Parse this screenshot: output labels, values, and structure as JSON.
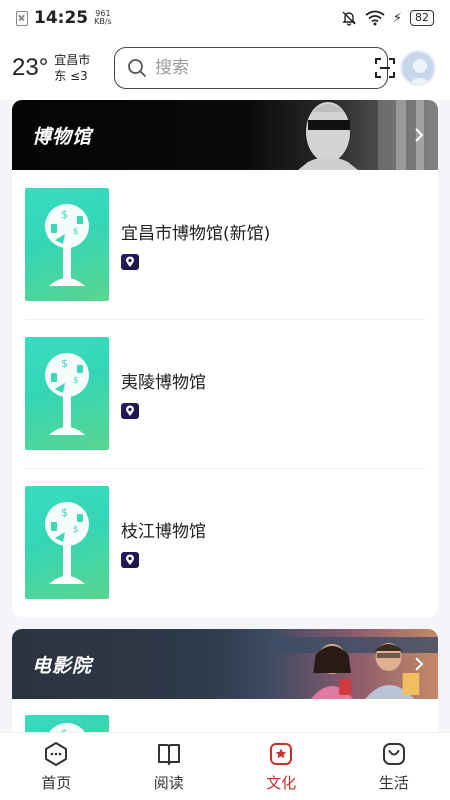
{
  "status": {
    "time": "14:25",
    "net_speed_value": "961",
    "net_speed_unit": "KB/s",
    "battery": "82"
  },
  "header": {
    "temperature": "23°",
    "city": "宜昌市",
    "wind": "东 ≤3",
    "search_placeholder": "搜索"
  },
  "sections": [
    {
      "title": "博物馆",
      "venues": [
        {
          "name": "宜昌市博物馆(新馆)"
        },
        {
          "name": "夷陵博物馆"
        },
        {
          "name": "枝江博物馆"
        }
      ]
    },
    {
      "title": "电影院"
    }
  ],
  "tabs": [
    {
      "label": "首页",
      "icon": "home-icon"
    },
    {
      "label": "阅读",
      "icon": "book-icon"
    },
    {
      "label": "文化",
      "icon": "culture-icon"
    },
    {
      "label": "生活",
      "icon": "life-icon"
    }
  ],
  "colors": {
    "accent": "#c9302c",
    "thumb_green": "#39dcc0"
  }
}
